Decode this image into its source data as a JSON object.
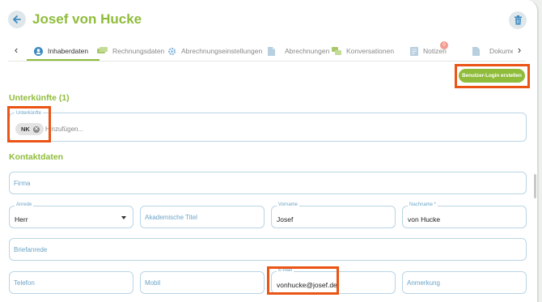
{
  "header": {
    "title": "Josef von Hucke"
  },
  "tabs": [
    {
      "label": "Inhaberdaten",
      "icon": "contact-icon",
      "active": true
    },
    {
      "label": "Rechnungsdaten",
      "icon": "money-icon"
    },
    {
      "label": "Abrechnungseinstellungen",
      "icon": "gear-icon"
    },
    {
      "label": "Abrechnungen",
      "icon": "document-icon"
    },
    {
      "label": "Konversationen",
      "icon": "chat-icon"
    },
    {
      "label": "Notizen",
      "icon": "note-icon",
      "badge": "0"
    },
    {
      "label": "Dokument",
      "icon": "file-icon"
    }
  ],
  "actions": {
    "create_login": "Benutzer-Login erstellen"
  },
  "accommodations": {
    "heading": "Unterkünfte (1)",
    "field_label": "Unterkünfte",
    "chip": "NK",
    "placeholder": "Hinzufügen..."
  },
  "contact": {
    "heading": "Kontaktdaten",
    "company": {
      "label": "Firma",
      "value": ""
    },
    "salutation": {
      "label": "Anrede",
      "value": "Herr"
    },
    "academic_title": {
      "label": "Akademische Titel",
      "value": ""
    },
    "first_name": {
      "label": "Vorname",
      "value": "Josef"
    },
    "last_name": {
      "label": "Nachname *",
      "value": "von Hucke"
    },
    "letter_salutation": {
      "label": "Briefanrede",
      "value": ""
    },
    "phone": {
      "label": "Telefon",
      "value": ""
    },
    "mobile": {
      "label": "Mobil",
      "value": ""
    },
    "email": {
      "label": "E-Mail",
      "value": "vonhucke@josef.de"
    },
    "note": {
      "label": "Anmerkung",
      "value": ""
    }
  },
  "colors": {
    "accent": "#8fbc3b",
    "highlight": "#ea5415",
    "field_border": "#b9d5e6",
    "label": "#6ba4c7"
  }
}
